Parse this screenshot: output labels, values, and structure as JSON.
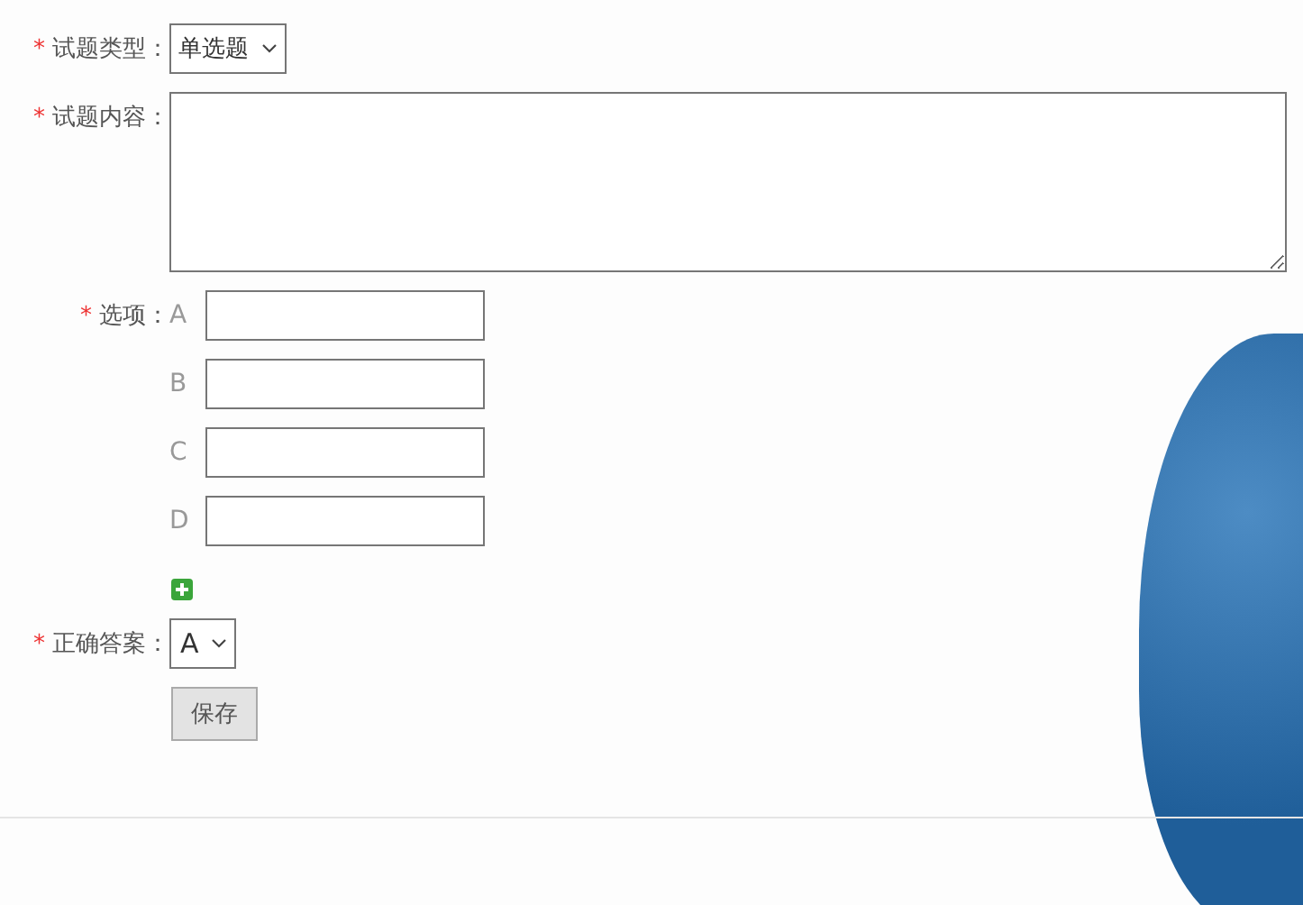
{
  "question_type": {
    "mark": "*",
    "label": "试题类型：",
    "value": "单选题"
  },
  "question_content": {
    "mark": "*",
    "label": "试题内容："
  },
  "options": {
    "mark": "*",
    "label": "选项：",
    "items": [
      {
        "letter": "A"
      },
      {
        "letter": "B"
      },
      {
        "letter": "C"
      },
      {
        "letter": "D"
      }
    ]
  },
  "correct_answer": {
    "mark": "*",
    "label": "正确答案：",
    "value": "A"
  },
  "save_button": "保存"
}
